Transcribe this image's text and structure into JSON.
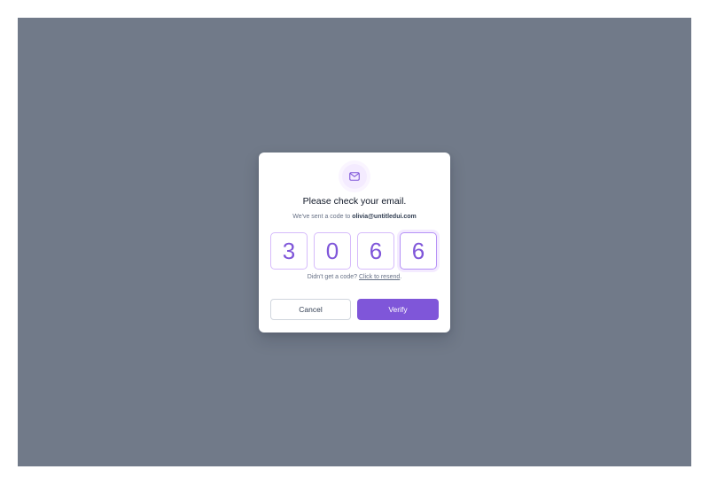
{
  "dialog": {
    "icon": "mail-icon",
    "title": "Please check your email.",
    "subtitle_prefix": "We've sent a code to ",
    "email": "olivia@untitledui.com",
    "code_digits": [
      "3",
      "0",
      "6",
      "6"
    ],
    "resend_prefix": "Didn't get a code? ",
    "resend_link": "Click to resend",
    "resend_suffix": ".",
    "cancel_label": "Cancel",
    "verify_label": "Verify"
  },
  "colors": {
    "backdrop": "#717a89",
    "accent": "#7f56d9",
    "digit_border": "#d6bbfb",
    "icon_bg": "#f4ebff"
  }
}
